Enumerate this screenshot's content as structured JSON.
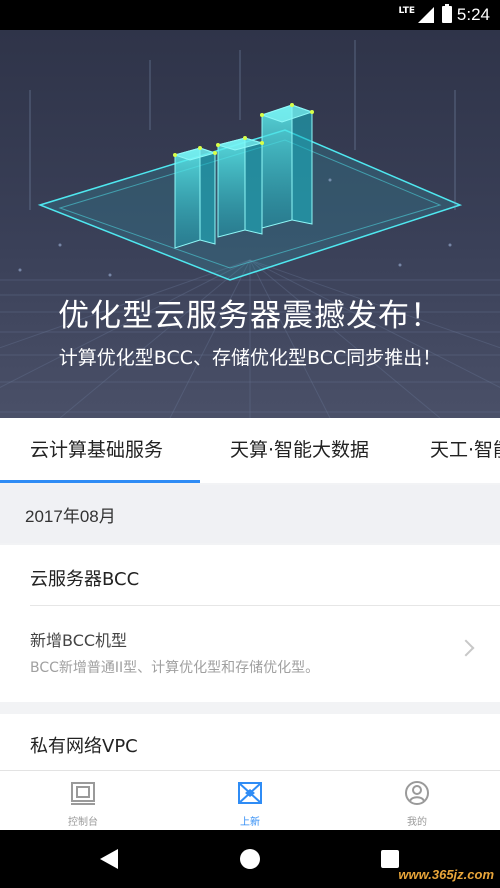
{
  "status_bar": {
    "network": "LTE",
    "time": "5:24"
  },
  "banner": {
    "headline": "优化型云服务器震撼发布！",
    "subline": "计算优化型BCC、存储优化型BCC同步推出！"
  },
  "tabs": [
    {
      "label": "云计算基础服务",
      "active": true
    },
    {
      "label": "天算·智能大数据",
      "active": false
    },
    {
      "label": "天工·智能",
      "active": false
    }
  ],
  "feed": {
    "date_header": "2017年08月",
    "cards": [
      {
        "title": "云服务器BCC",
        "item_title": "新增BCC机型",
        "item_desc": "BCC新增普通II型、计算优化型和存储优化型。"
      },
      {
        "title": "私有网络VPC"
      }
    ]
  },
  "bottom_nav": [
    {
      "label": "控制台",
      "icon": "console-icon",
      "active": false
    },
    {
      "label": "上新",
      "icon": "whats-new-icon",
      "active": true
    },
    {
      "label": "我的",
      "icon": "profile-icon",
      "active": false
    }
  ],
  "watermark": "www.365jz.com",
  "colors": {
    "accent": "#2f8cf5",
    "banner_bg": "#353a50",
    "cyan": "#3ee6e6"
  }
}
